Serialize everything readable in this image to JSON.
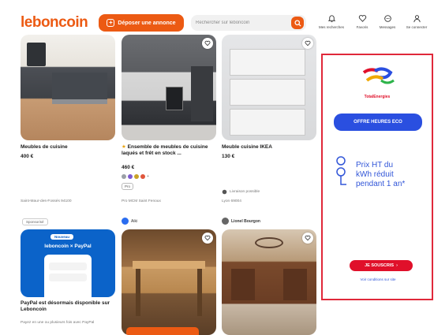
{
  "header": {
    "logo": "leboncoin",
    "deposit_label": "Déposer une annonce",
    "search_placeholder": "Rechercher sur leboncoin",
    "nav": [
      {
        "label": "Mes recherches",
        "icon": "bell-icon"
      },
      {
        "label": "Favoris",
        "icon": "heart-icon"
      },
      {
        "label": "Messages",
        "icon": "message-icon"
      },
      {
        "label": "Se connecter",
        "icon": "user-icon"
      }
    ]
  },
  "listings": [
    {
      "title": "Meubles de cuisine",
      "price": "400 €",
      "location": "Saint-Maur-des-Fossés 94100"
    },
    {
      "title": "Ensemble de meubles de cuisine laqués et frêt en stock ...",
      "price": "460 €",
      "badge": "Pro",
      "location": "Pro MCM Saint Fenoux",
      "color_dots": [
        "#9aa0a6",
        "#7d5bd1",
        "#c9a227",
        "#e0563c"
      ],
      "color_more": "+"
    },
    {
      "title": "Meuble cuisine IKEA",
      "price": "130 €",
      "delivery": "Livraison possible",
      "location": "Lyon 69004"
    }
  ],
  "promo": {
    "sponsored": "Sponsorisé",
    "brand_line": "leboncoin × PayPal",
    "tag": "Nouveau",
    "title": "PayPal est désormais disponible sur Leboncoin",
    "desc": "Payez en une ou plusieurs fois avec PayPal"
  },
  "row2": [
    {
      "seller": "Aiki"
    },
    {
      "seller": "Lionel Bourgon"
    }
  ],
  "ad": {
    "brand": "TotalEnergies",
    "cta": "OFFRE HEURES ECO",
    "headline": [
      "Prix HT du",
      "kWh réduit",
      "pendant 1 an*"
    ],
    "subscribe": "JE SOUSCRIS",
    "conditions": "Voir conditions sur site"
  },
  "colors": {
    "brand": "#ec5a13",
    "ad_border": "#e0283a",
    "ad_blue": "#2a4fe0",
    "ad_red": "#e0102a"
  }
}
